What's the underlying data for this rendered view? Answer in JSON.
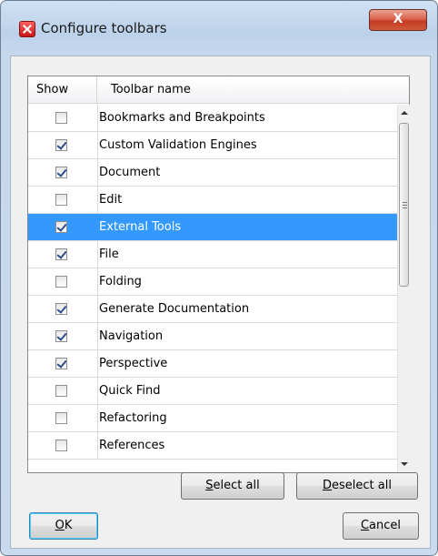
{
  "window": {
    "title": "Configure toolbars",
    "close_label": "X",
    "accent": "#3399ff"
  },
  "table": {
    "headers": {
      "show": "Show",
      "name": "Toolbar name"
    },
    "rows": [
      {
        "name": "Bookmarks and Breakpoints",
        "checked": false,
        "selected": false
      },
      {
        "name": "Custom Validation Engines",
        "checked": true,
        "selected": false
      },
      {
        "name": "Document",
        "checked": true,
        "selected": false
      },
      {
        "name": "Edit",
        "checked": false,
        "selected": false
      },
      {
        "name": "External Tools",
        "checked": true,
        "selected": true
      },
      {
        "name": "File",
        "checked": true,
        "selected": false
      },
      {
        "name": "Folding",
        "checked": false,
        "selected": false
      },
      {
        "name": "Generate Documentation",
        "checked": true,
        "selected": false
      },
      {
        "name": "Navigation",
        "checked": true,
        "selected": false
      },
      {
        "name": "Perspective",
        "checked": true,
        "selected": false
      },
      {
        "name": "Quick Find",
        "checked": false,
        "selected": false
      },
      {
        "name": "Refactoring",
        "checked": false,
        "selected": false
      },
      {
        "name": "References",
        "checked": false,
        "selected": false
      }
    ]
  },
  "buttons": {
    "select_all": {
      "mnemonic": "S",
      "rest": "elect all"
    },
    "deselect_all": {
      "mnemonic": "D",
      "rest": "eselect all"
    },
    "ok": {
      "mnemonic": "O",
      "rest": "K"
    },
    "cancel": {
      "mnemonic": "C",
      "rest": "ancel"
    }
  }
}
